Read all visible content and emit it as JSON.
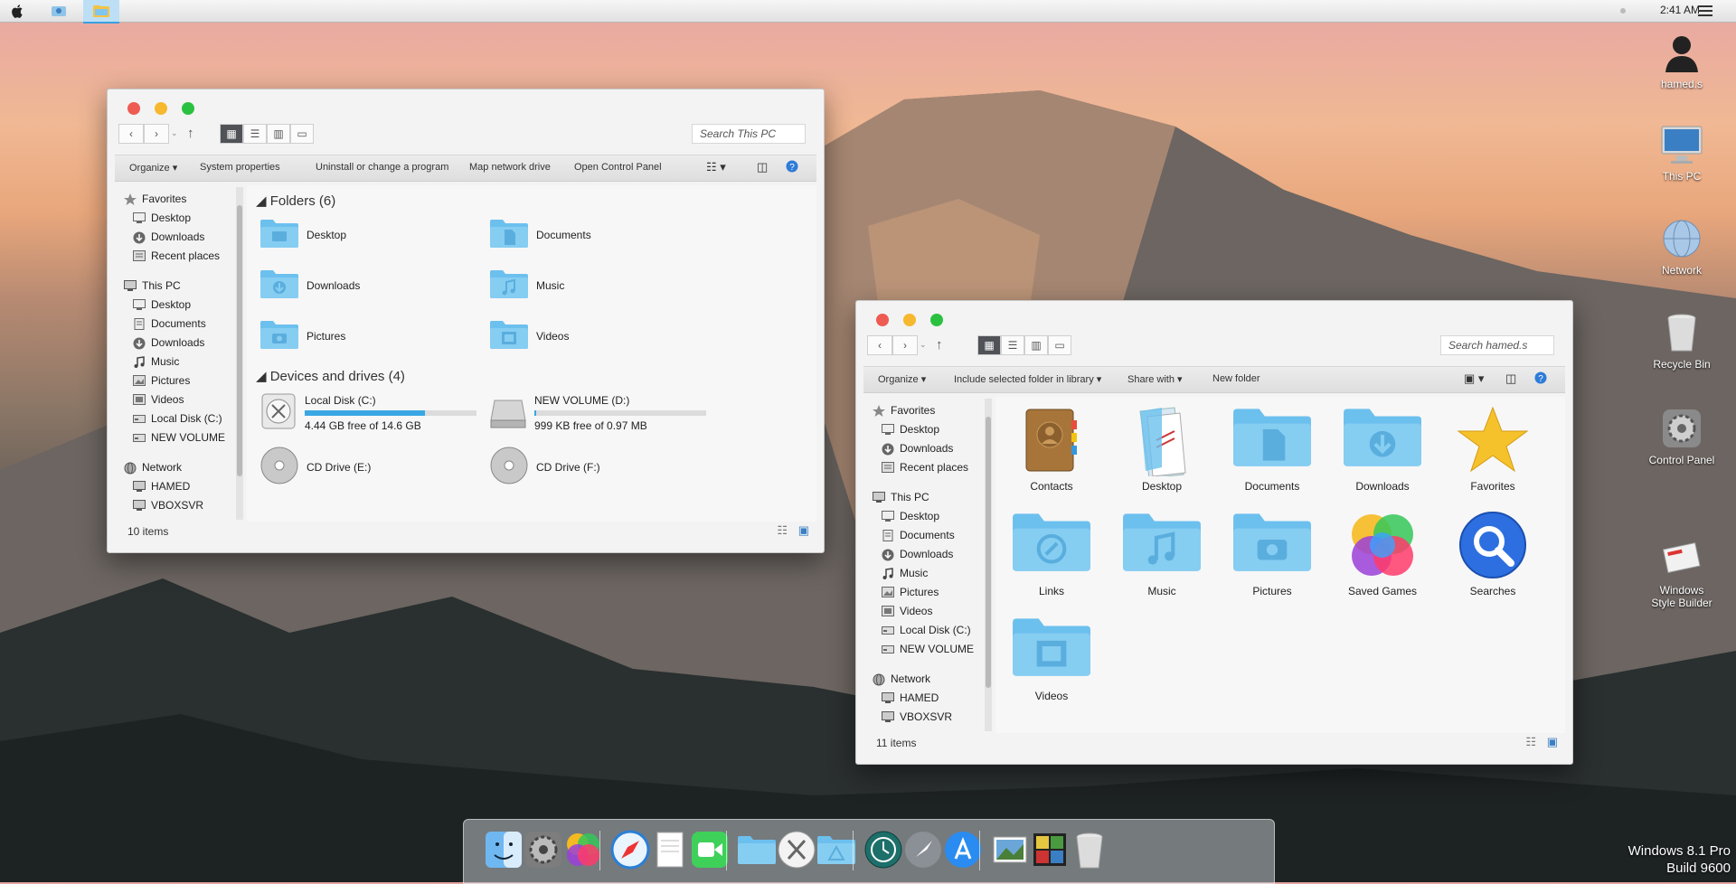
{
  "menubar": {
    "clock": "2:41 AM"
  },
  "desktop_icons": [
    {
      "label": "hamed.s",
      "icon": "user-icon"
    },
    {
      "label": "This PC",
      "icon": "monitor-icon"
    },
    {
      "label": "Network",
      "icon": "network-globe-icon"
    },
    {
      "label": "Recycle Bin",
      "icon": "recycle-bin-icon"
    },
    {
      "label": "Control Panel",
      "icon": "control-panel-icon"
    },
    {
      "label": "Windows\nStyle Builder",
      "icon": "style-builder-icon"
    }
  ],
  "win1": {
    "search_placeholder": "Search This PC",
    "commands": [
      "Organize ▾",
      "System properties",
      "Uninstall or change a program",
      "Map network drive",
      "Open Control Panel"
    ],
    "nav": [
      {
        "label": "Favorites",
        "icon": "star-icon",
        "level": 0
      },
      {
        "label": "Desktop",
        "icon": "desktop-icon",
        "level": 1
      },
      {
        "label": "Downloads",
        "icon": "download-icon",
        "level": 1
      },
      {
        "label": "Recent places",
        "icon": "recent-icon",
        "level": 1
      },
      {
        "label": "This PC",
        "icon": "computer-icon",
        "level": 0
      },
      {
        "label": "Desktop",
        "icon": "desktop-icon",
        "level": 1
      },
      {
        "label": "Documents",
        "icon": "documents-icon",
        "level": 1
      },
      {
        "label": "Downloads",
        "icon": "download-icon",
        "level": 1
      },
      {
        "label": "Music",
        "icon": "music-icon",
        "level": 1
      },
      {
        "label": "Pictures",
        "icon": "pictures-icon",
        "level": 1
      },
      {
        "label": "Videos",
        "icon": "videos-icon",
        "level": 1
      },
      {
        "label": "Local Disk (C:)",
        "icon": "disk-icon",
        "level": 1
      },
      {
        "label": "NEW VOLUME",
        "icon": "disk-icon",
        "level": 1
      },
      {
        "label": "Network",
        "icon": "network-icon",
        "level": 0
      },
      {
        "label": "HAMED",
        "icon": "computer-icon",
        "level": 1
      },
      {
        "label": "VBOXSVR",
        "icon": "computer-icon",
        "level": 1
      }
    ],
    "folders_heading": "Folders (6)",
    "folders": [
      "Desktop",
      "Documents",
      "Downloads",
      "Music",
      "Pictures",
      "Videos"
    ],
    "drives_heading": "Devices and drives (4)",
    "drives": [
      {
        "name": "Local Disk (C:)",
        "free": "4.44 GB free of 14.6 GB",
        "used_fraction": 0.7
      },
      {
        "name": "NEW VOLUME (D:)",
        "free": "999 KB free of 0.97 MB",
        "used_fraction": 0.01
      },
      {
        "name": "CD Drive (E:)"
      },
      {
        "name": "CD Drive (F:)"
      }
    ],
    "status": "10 items"
  },
  "win2": {
    "search_placeholder": "Search hamed.s",
    "commands": [
      "Organize ▾",
      "Include selected folder in library ▾",
      "Share with ▾",
      "New folder"
    ],
    "nav": [
      {
        "label": "Favorites",
        "icon": "star-icon",
        "level": 0
      },
      {
        "label": "Desktop",
        "icon": "desktop-icon",
        "level": 1
      },
      {
        "label": "Downloads",
        "icon": "download-icon",
        "level": 1
      },
      {
        "label": "Recent places",
        "icon": "recent-icon",
        "level": 1
      },
      {
        "label": "This PC",
        "icon": "computer-icon",
        "level": 0
      },
      {
        "label": "Desktop",
        "icon": "desktop-icon",
        "level": 1
      },
      {
        "label": "Documents",
        "icon": "documents-icon",
        "level": 1
      },
      {
        "label": "Downloads",
        "icon": "download-icon",
        "level": 1
      },
      {
        "label": "Music",
        "icon": "music-icon",
        "level": 1
      },
      {
        "label": "Pictures",
        "icon": "pictures-icon",
        "level": 1
      },
      {
        "label": "Videos",
        "icon": "videos-icon",
        "level": 1
      },
      {
        "label": "Local Disk (C:)",
        "icon": "disk-icon",
        "level": 1
      },
      {
        "label": "NEW VOLUME",
        "icon": "disk-icon",
        "level": 1
      },
      {
        "label": "Network",
        "icon": "network-icon",
        "level": 0
      },
      {
        "label": "HAMED",
        "icon": "computer-icon",
        "level": 1
      },
      {
        "label": "VBOXSVR",
        "icon": "computer-icon",
        "level": 1
      }
    ],
    "items": [
      {
        "label": "Contacts",
        "icon": "contacts-icon"
      },
      {
        "label": "Desktop",
        "icon": "desktop-folder-icon"
      },
      {
        "label": "Documents",
        "icon": "documents-folder-icon"
      },
      {
        "label": "Downloads",
        "icon": "downloads-folder-icon"
      },
      {
        "label": "Favorites",
        "icon": "star-icon"
      },
      {
        "label": "Links",
        "icon": "links-folder-icon"
      },
      {
        "label": "Music",
        "icon": "music-folder-icon"
      },
      {
        "label": "Pictures",
        "icon": "pictures-folder-icon"
      },
      {
        "label": "Saved Games",
        "icon": "saved-games-icon"
      },
      {
        "label": "Searches",
        "icon": "search-icon"
      },
      {
        "label": "Videos",
        "icon": "videos-folder-icon"
      }
    ],
    "status": "11 items"
  },
  "dock": [
    "finder-icon",
    "system-preferences-icon",
    "game-center-icon",
    "safari-icon",
    "textedit-icon",
    "facetime-icon",
    "folder-icon",
    "osx-icon",
    "applications-folder-icon",
    "time-machine-icon",
    "launchpad-icon",
    "app-store-icon",
    "preview-icon",
    "photo-booth-icon",
    "trash-icon"
  ],
  "watermark": {
    "line1": "Windows 8.1 Pro",
    "line2": "Build 9600"
  },
  "colors": {
    "folder": "#6cc0ee",
    "folder_tab": "#86cdf2",
    "close": "#ee5b52",
    "minimize": "#f6b82e",
    "zoom": "#2bc140",
    "drive_bar": "#3aa7e4"
  }
}
